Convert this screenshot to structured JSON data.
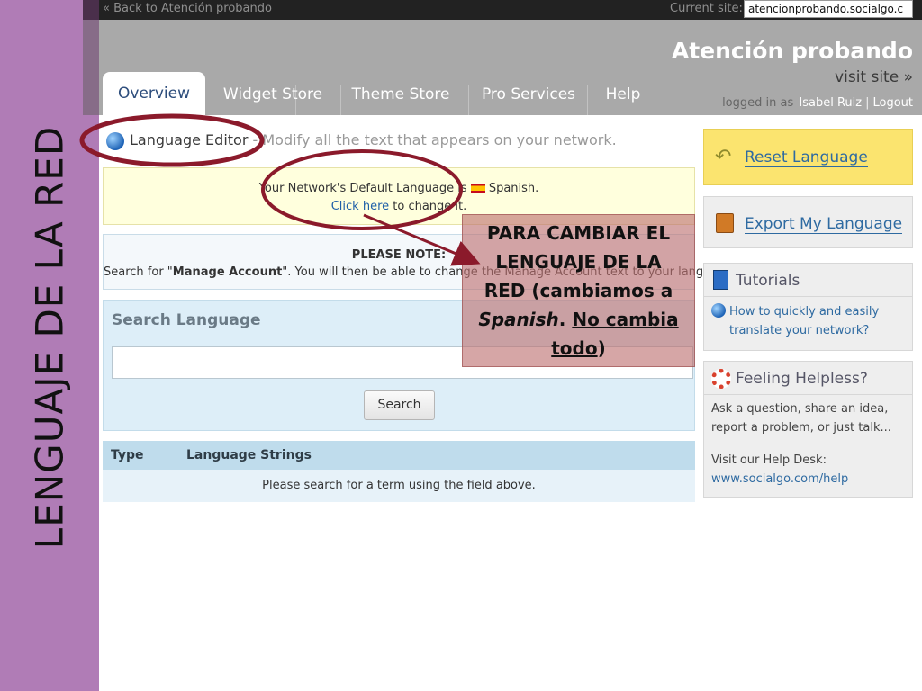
{
  "slide": {
    "title": "LENGUAJE DE LA RED"
  },
  "topbar": {
    "back_link": "« Back to Atención probando",
    "current_site_label": "Current site:",
    "current_site_value": "atencionprobando.socialgo.c"
  },
  "header": {
    "site_title": "Atención probando",
    "visit_site": "visit site »",
    "logged_in_as": "logged in as",
    "user": "Isabel Ruiz",
    "logout": "Logout"
  },
  "tabs": [
    {
      "label": "Overview"
    },
    {
      "label": "Widget Store"
    },
    {
      "label": "Theme Store"
    },
    {
      "label": "Pro Services"
    },
    {
      "label": "Help"
    }
  ],
  "main": {
    "section_title": "Language Editor",
    "section_desc": "- Modify all the text that appears on your network.",
    "notice": {
      "prefix": "Your Network's Default Language is",
      "language": "Spanish.",
      "click_here": "Click here",
      "suffix": "to change it."
    },
    "note": {
      "title": "PLEASE NOTE:",
      "text_before": "Search for \"",
      "text_bold": "Manage Account",
      "text_after": "\". You will then be able to change the Manage Account text to your language."
    },
    "search": {
      "title": "Search Language",
      "input_value": "",
      "button": "Search"
    },
    "results": {
      "columns": [
        "Type",
        "Language Strings"
      ],
      "empty_message": "Please search for a term using the field above."
    }
  },
  "sidebar": {
    "reset": "Reset Language",
    "export": "Export My Language",
    "tutorials": {
      "title": "Tutorials",
      "link": "How to quickly and easily translate your network?"
    },
    "helpless": {
      "title": "Feeling Helpless?",
      "text": "Ask a question, share an idea, report a problem, or just talk...",
      "helpdesk_label": "Visit our Help Desk:",
      "helpdesk_url": "www.socialgo.com/help"
    }
  },
  "callout": {
    "line1": "PARA CAMBIAR EL",
    "line2": "LENGUAJE DE LA",
    "line3_a": "RED (cambiamos a",
    "line4_italic": "Spanish",
    "line4_dot": ". ",
    "line4_underline": "No cambia",
    "line5_underline": "todo",
    "line5_end": ")"
  },
  "colors": {
    "side_band": "#b07cb6",
    "annotation_red": "#8b1a2b",
    "callout_fill": "#bd6f6f",
    "reset_yellow": "#fbe46f",
    "link_blue": "#2e6aa1"
  }
}
